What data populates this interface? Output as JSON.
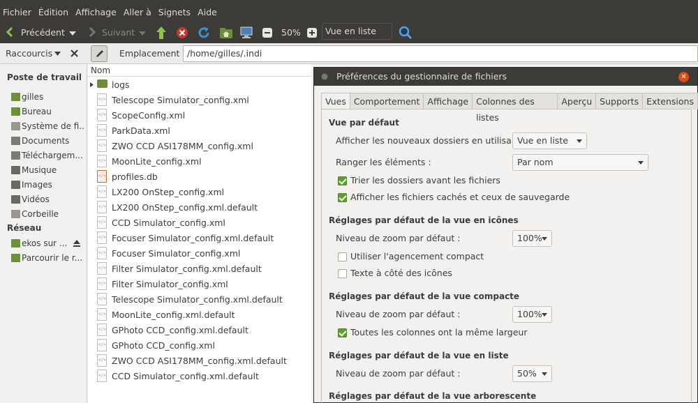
{
  "menu": [
    "Fichier",
    "Édition",
    "Affichage",
    "Aller à",
    "Signets",
    "Aide"
  ],
  "toolbar": {
    "back_label": "Précédent",
    "forward_label": "Suivant",
    "zoom": "50%",
    "view_mode": "Vue en liste"
  },
  "location": {
    "shortcuts_label": "Raccourcis",
    "location_label": "Emplacement :",
    "path": "/home/gilles/.indi"
  },
  "sidebar": {
    "section_computer": "Poste de travail",
    "items": [
      "gilles",
      "Bureau",
      "Système de fi...",
      "Documents",
      "Téléchargem...",
      "Musique",
      "Images",
      "Vidéos",
      "Corbeille"
    ],
    "section_network": "Réseau",
    "network_items": [
      "ekos sur ...",
      "Parcourir le r..."
    ]
  },
  "filelist": {
    "column": "Nom",
    "folder": "logs",
    "files": [
      "Telescope Simulator_config.xml",
      "ScopeConfig.xml",
      "ParkData.xml",
      "ZWO CCD ASI178MM_config.xml",
      "MoonLite_config.xml",
      "profiles.db",
      "LX200 OnStep_config.xml",
      "LX200 OnStep_config.xml.default",
      "CCD Simulator_config.xml",
      "Focuser Simulator_config.xml.default",
      "Focuser Simulator_config.xml",
      "Filter Simulator_config.xml.default",
      "Filter Simulator_config.xml",
      "Telescope Simulator_config.xml.default",
      "MoonLite_config.xml.default",
      "GPhoto CCD_config.xml.default",
      "GPhoto CCD_config.xml",
      "ZWO CCD ASI178MM_config.xml.default",
      "CCD Simulator_config.xml.default"
    ]
  },
  "dialog": {
    "title": "Préférences du gestionnaire de fichiers",
    "tabs": [
      "Vues",
      "Comportement",
      "Affichage",
      "Colonnes des listes",
      "Aperçu",
      "Supports",
      "Extensions"
    ],
    "default_view": {
      "heading": "Vue par défaut",
      "open_with_label": "Afficher les nouveaux dossiers en utilisant :",
      "open_with_value": "Vue en liste",
      "sort_label": "Ranger les éléments :",
      "sort_value": "Par nom",
      "folders_first": "Trier les dossiers avant les fichiers",
      "show_hidden": "Afficher les fichiers cachés et ceux de sauvegarde"
    },
    "icon_view": {
      "heading": "Réglages par défaut de la vue en icônes",
      "zoom_label": "Niveau de zoom par défaut :",
      "zoom_value": "100%",
      "compact_layout": "Utiliser l'agencement compact",
      "text_beside": "Texte à côté des icônes"
    },
    "compact_view": {
      "heading": "Réglages par défaut de la vue compacte",
      "zoom_label": "Niveau de zoom par défaut :",
      "zoom_value": "100%",
      "same_width": "Toutes les colonnes ont la même largeur"
    },
    "list_view": {
      "heading": "Réglages par défaut de la vue en liste",
      "zoom_label": "Niveau de zoom par défaut :",
      "zoom_value": "50%"
    },
    "tree_view": {
      "heading": "Réglages par défaut de la vue arborescente"
    }
  },
  "colors": {
    "accent": "#5aa02c",
    "close": "#df4a16",
    "titlebar": "#3c3b37"
  }
}
